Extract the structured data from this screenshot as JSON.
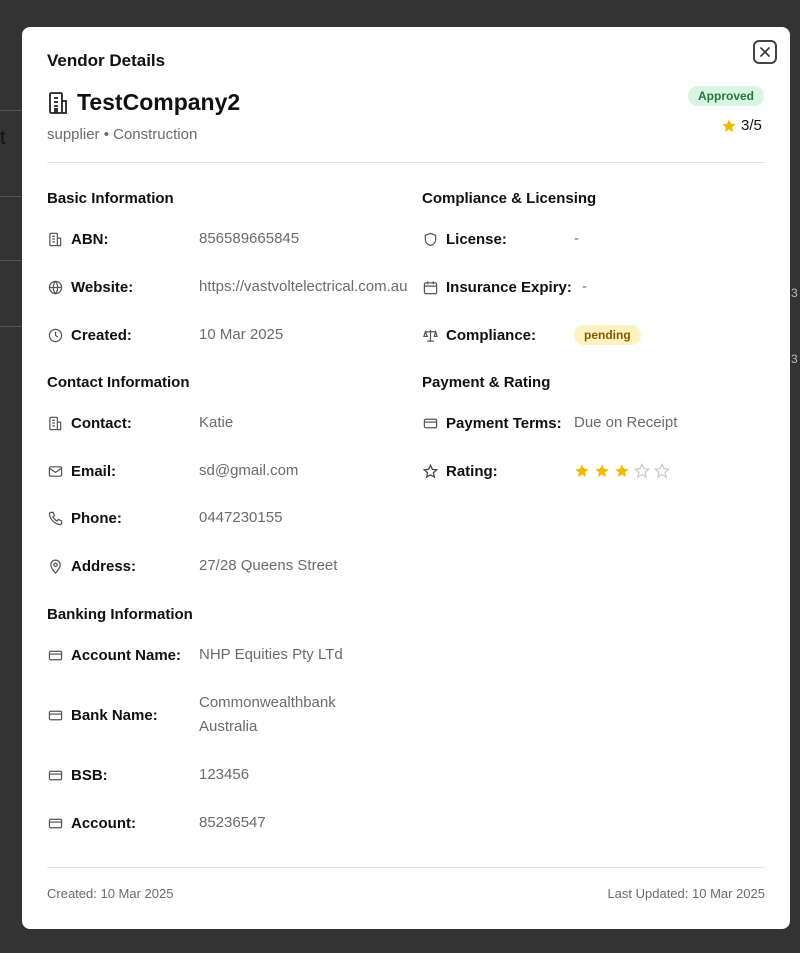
{
  "background": {
    "fragment_text": "t",
    "right_digit_1": "3",
    "right_digit_2": "3"
  },
  "modal": {
    "title": "Vendor Details",
    "company_name": "TestCompany2",
    "subtitle": "supplier • Construction",
    "status": "Approved",
    "rating_summary": "3/5"
  },
  "sections": {
    "basic": {
      "title": "Basic Information",
      "abn_label": "ABN:",
      "abn_value": "856589665845",
      "website_label": "Website:",
      "website_value": "https://vastvoltelectrical.com.au",
      "created_label": "Created:",
      "created_value": "10 Mar 2025"
    },
    "contact": {
      "title": "Contact Information",
      "contact_label": "Contact:",
      "contact_value": "Katie",
      "email_label": "Email:",
      "email_value": "sd@gmail.com",
      "phone_label": "Phone:",
      "phone_value": "0447230155",
      "address_label": "Address:",
      "address_value": "27/28 Queens Street"
    },
    "banking": {
      "title": "Banking Information",
      "account_name_label": "Account Name:",
      "account_name_value": "NHP Equities Pty LTd",
      "bank_name_label": "Bank Name:",
      "bank_name_value": "Commonwealthbank Australia",
      "bsb_label": "BSB:",
      "bsb_value": "123456",
      "account_label": "Account:",
      "account_value": "85236547"
    },
    "compliance": {
      "title": "Compliance & Licensing",
      "license_label": "License:",
      "license_value": "-",
      "insurance_label": "Insurance Expiry:",
      "insurance_value": "-",
      "compliance_label": "Compliance:",
      "compliance_status": "pending"
    },
    "payment": {
      "title": "Payment & Rating",
      "terms_label": "Payment Terms:",
      "terms_value": "Due on Receipt",
      "rating_label": "Rating:",
      "rating_value": 3,
      "rating_max": 5
    }
  },
  "footer": {
    "created": "Created: 10 Mar 2025",
    "updated": "Last Updated: 10 Mar 2025"
  },
  "colors": {
    "star_filled": "#f5b800",
    "star_empty": "#c8c8c8",
    "approved_bg": "#d9f5e1",
    "pending_bg": "#fdf3c0"
  }
}
